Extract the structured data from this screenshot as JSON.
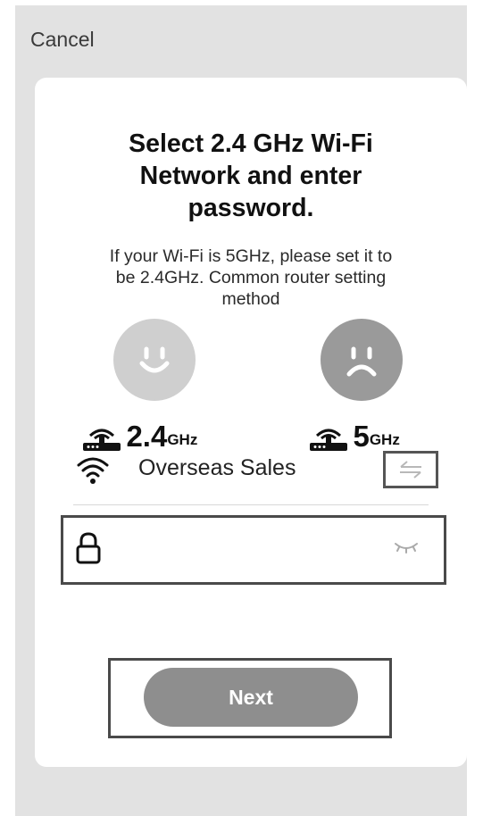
{
  "header": {
    "cancel_label": "Cancel"
  },
  "card": {
    "title_line1": "Select 2.4 GHz Wi-Fi",
    "title_line2": "Network and enter",
    "title_line3": "password.",
    "subtitle_line1": "If your Wi-Fi is 5GHz, please set it to",
    "subtitle_line2": "be 2.4GHz. Common router setting",
    "subtitle_line3": "method"
  },
  "bands": [
    {
      "number": "2.4",
      "unit": "GHz",
      "face": "happy-face-icon"
    },
    {
      "number": "5",
      "unit": "GHz",
      "face": "sad-face-icon"
    }
  ],
  "network": {
    "name": "Overseas Sales",
    "icon": "wifi-icon",
    "switch_icon": "switch-network-icon"
  },
  "password": {
    "value": "",
    "placeholder": "",
    "lock_icon": "lock-icon",
    "visibility_icon": "eye-closed-icon"
  },
  "actions": {
    "next_label": "Next"
  },
  "colors": {
    "background": "#e2e2e2",
    "card": "#ffffff",
    "button": "#8e8e8e",
    "happy_face": "#cfcfcf",
    "sad_face": "#9a9a9a"
  }
}
